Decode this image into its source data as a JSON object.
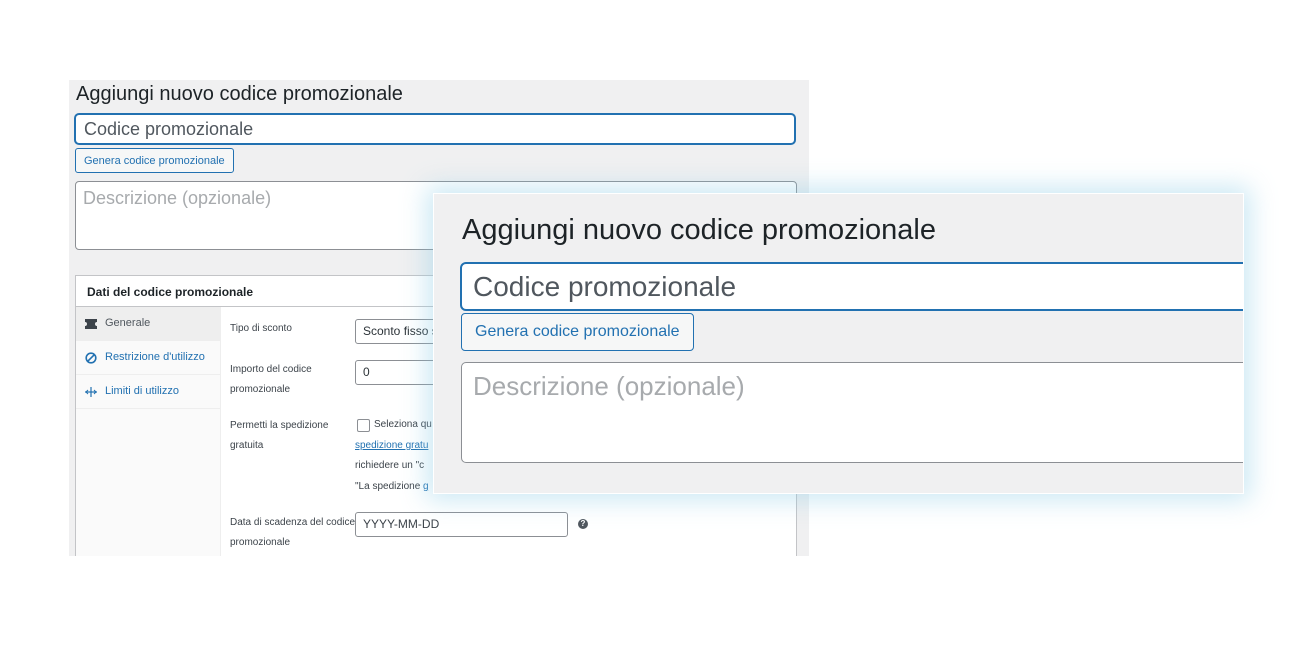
{
  "background": {
    "title": "Aggiungi nuovo codice promozionale",
    "coupon_code_placeholder": "Codice promozionale",
    "generate_button_label": "Genera codice promozionale",
    "description_placeholder": "Descrizione (opzionale)",
    "coupon_data": {
      "heading": "Dati del codice promozionale",
      "tabs": [
        {
          "label": "Generale",
          "icon": "ticket-icon",
          "active": true
        },
        {
          "label": "Restrizione d'utilizzo",
          "icon": "block-icon",
          "active": false
        },
        {
          "label": "Limiti di utilizzo",
          "icon": "arrows-icon",
          "active": false
        }
      ],
      "discount_type": {
        "label": "Tipo di sconto",
        "value": "Sconto fisso s"
      },
      "coupon_amount": {
        "label_line1": "Importo del codice",
        "label_line2": "promozionale",
        "value": "0"
      },
      "free_shipping": {
        "label_line1": "Permetti la spedizione",
        "label_line2": "gratuita",
        "text_line1": "Seleziona qu",
        "link_text": "spedizione gratu",
        "text_line3": "richiedere un \"c",
        "text_line4_prefix": "\"La spedizione ",
        "text_line4_link": "g"
      },
      "expiry_date": {
        "label_line1": "Data di scadenza del codice",
        "label_line2": "promozionale",
        "placeholder": "YYYY-MM-DD",
        "help": "?"
      }
    }
  },
  "foreground": {
    "title": "Aggiungi nuovo codice promozionale",
    "coupon_code_placeholder": "Codice promozionale",
    "generate_button_label": "Genera codice promozionale",
    "description_placeholder": "Descrizione (opzionale)"
  },
  "colors": {
    "accent": "#2271b1",
    "panel_bg": "#f0f0f1",
    "border": "#8c8f94"
  }
}
